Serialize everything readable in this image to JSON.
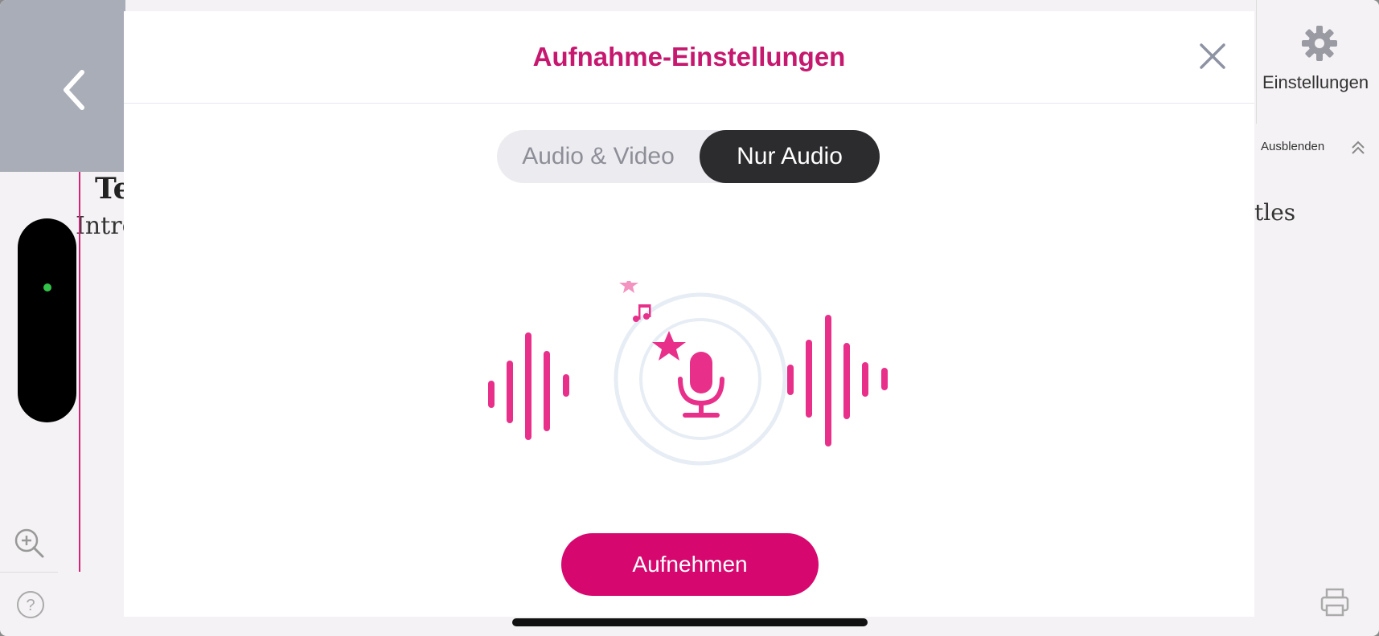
{
  "background": {
    "back_icon": "chevron-left-icon",
    "score_title": "Te",
    "score_subtitle": "Intro",
    "score_right_text": "tles",
    "settings": {
      "icon": "gear-icon",
      "label": "Einstellungen"
    },
    "ausblenden": {
      "label": "Ausblenden",
      "icon": "double-chevron-up-icon"
    },
    "zoom_icon": "zoom-in-icon",
    "help_icon": "help-icon",
    "print_icon": "printer-icon"
  },
  "modal": {
    "title": "Aufnahme-Einstellungen",
    "close_icon": "close-icon",
    "segments": [
      {
        "label": "Audio & Video",
        "selected": false
      },
      {
        "label": "Nur Audio",
        "selected": true
      }
    ],
    "illustration": "microphone-with-soundwaves",
    "record_label": "Aufnehmen"
  },
  "colors": {
    "accent": "#d6076f",
    "title": "#c5186e",
    "segment_selected_bg": "#2c2c2e",
    "indicator": "#33c24a"
  }
}
